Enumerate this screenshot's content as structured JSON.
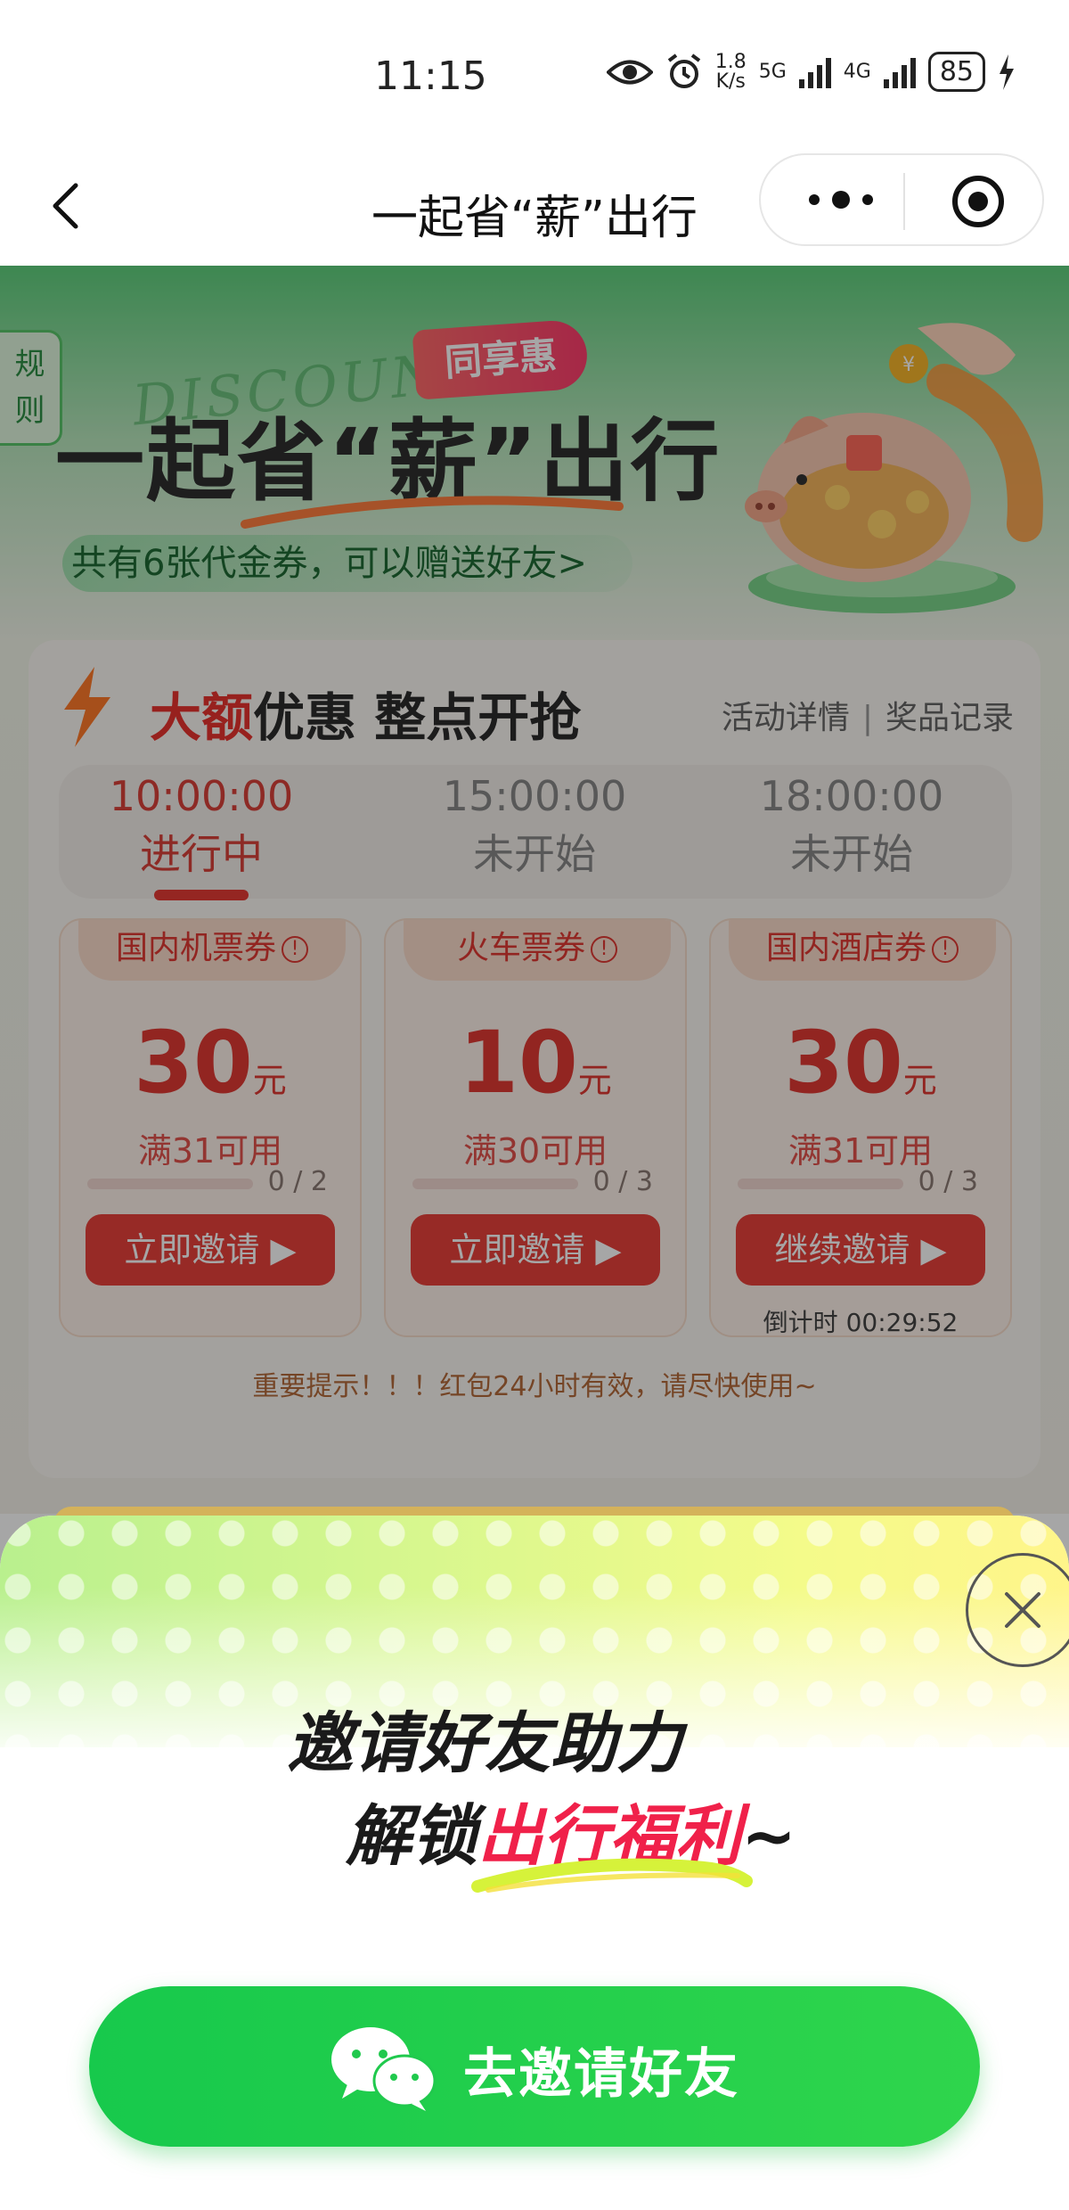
{
  "status_bar": {
    "time": "11:15",
    "net_speed_top": "1.8",
    "net_speed_bottom": "K/s",
    "sim1": "5G",
    "sim2": "4G",
    "battery": "85"
  },
  "nav": {
    "title": "一起省“薪”出行",
    "capsule_icons": [
      "more-icon",
      "target-icon"
    ]
  },
  "banner": {
    "rules_tab": "规则",
    "discount_script": "DISCOUNT",
    "tag": "同享惠",
    "title": "一起省“薪”出行",
    "coupon_link": "共有6张代金券，可以赠送好友>"
  },
  "section": {
    "title_red": "大额",
    "title_rest": "优惠 整点开抢",
    "link_details": "活动详情",
    "link_records": "奖品记录"
  },
  "time_tabs": [
    {
      "time": "10:00:00",
      "status": "进行中",
      "active": true
    },
    {
      "time": "15:00:00",
      "status": "未开始",
      "active": false
    },
    {
      "time": "18:00:00",
      "status": "未开始",
      "active": false
    }
  ],
  "cards": [
    {
      "name": "国内机票券",
      "amount": "30",
      "unit": "元",
      "condition": "满31可用",
      "progress": "0 / 2",
      "progress_value": 0,
      "button": "立即邀请 ▶",
      "countdown": ""
    },
    {
      "name": "火车票券",
      "amount": "10",
      "unit": "元",
      "condition": "满30可用",
      "progress": "0 / 3",
      "progress_value": 0,
      "button": "立即邀请 ▶",
      "countdown": ""
    },
    {
      "name": "国内酒店券",
      "amount": "30",
      "unit": "元",
      "condition": "满31可用",
      "progress": "0 / 3",
      "progress_value": 0,
      "button": "继续邀请 ▶",
      "countdown": "倒计时 00:29:52"
    }
  ],
  "tip": "重要提示！！！红包24小时有效，请尽快使用~",
  "sheet": {
    "line1": "邀请好友助力",
    "line2_pre": "解锁",
    "line2_highlight": "出行福利",
    "line2_post": "~",
    "button_label": "去邀请好友"
  },
  "colors": {
    "accent_red": "#e8413b",
    "wechat_green": "#1fcc4c",
    "title_green": "#2f8f45"
  }
}
